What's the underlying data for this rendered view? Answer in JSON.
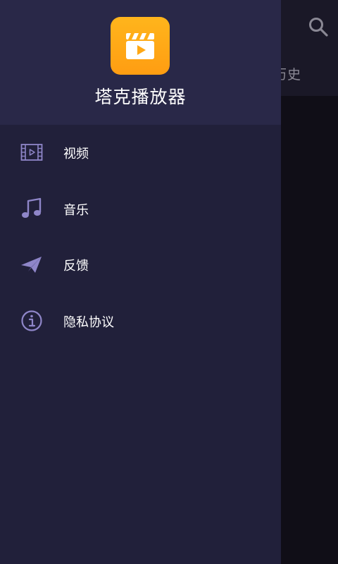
{
  "background": {
    "search_icon": "search-icon",
    "tab_partial_label": "历史"
  },
  "drawer": {
    "app_name": "塔克播放器",
    "logo_icon": "clapperboard-play-icon",
    "menu_items": [
      {
        "label": "视频",
        "icon": "film-icon"
      },
      {
        "label": "音乐",
        "icon": "music-note-icon"
      },
      {
        "label": "反馈",
        "icon": "paper-plane-icon"
      },
      {
        "label": "隐私协议",
        "icon": "info-icon"
      }
    ]
  },
  "colors": {
    "drawer_bg": "#21203a",
    "drawer_header_bg": "#292848",
    "icon_color": "#8f86c9",
    "logo_gradient": [
      "#ffb51c",
      "#ff9d12"
    ]
  }
}
